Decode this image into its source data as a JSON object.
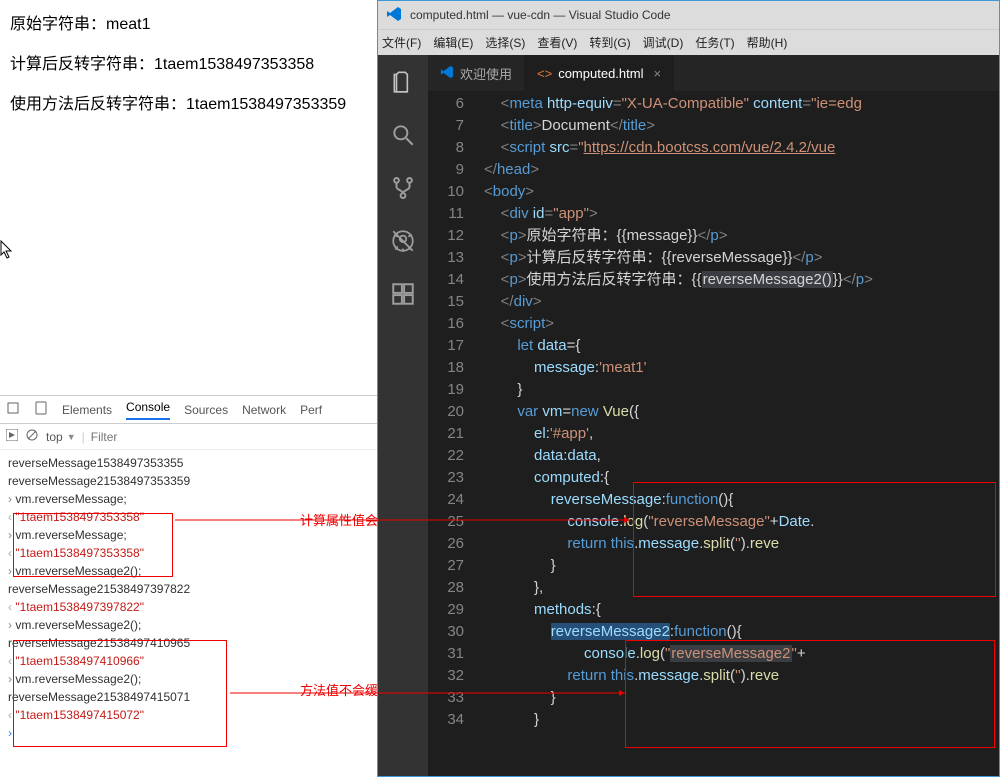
{
  "browser": {
    "line1_label": "原始字符串：",
    "line1_value": "meat1",
    "line2_label": "计算后反转字符串：",
    "line2_value": "1taem1538497353358",
    "line3_label": "使用方法后反转字符串：",
    "line3_value": "1taem1538497353359"
  },
  "devtools": {
    "tabs": {
      "elements": "Elements",
      "console": "Console",
      "sources": "Sources",
      "network": "Network",
      "perf": "Perf"
    },
    "top": "top",
    "filter_placeholder": "Filter",
    "console": [
      {
        "t": "log",
        "txt": "reverseMessage1538497353355"
      },
      {
        "t": "log",
        "txt": "reverseMessage21538497353359"
      },
      {
        "t": "in",
        "txt": "vm.reverseMessage;"
      },
      {
        "t": "out",
        "txt": "\"1taem1538497353358\""
      },
      {
        "t": "in",
        "txt": "vm.reverseMessage;"
      },
      {
        "t": "out",
        "txt": "\"1taem1538497353358\""
      },
      {
        "t": "in",
        "txt": "vm.reverseMessage2();"
      },
      {
        "t": "log",
        "txt": "reverseMessage21538497397822"
      },
      {
        "t": "out",
        "txt": "\"1taem1538497397822\""
      },
      {
        "t": "in",
        "txt": "vm.reverseMessage2();"
      },
      {
        "t": "log",
        "txt": "reverseMessage21538497410965"
      },
      {
        "t": "out",
        "txt": "\"1taem1538497410966\""
      },
      {
        "t": "in",
        "txt": "vm.reverseMessage2();"
      },
      {
        "t": "log",
        "txt": "reverseMessage21538497415071"
      },
      {
        "t": "out",
        "txt": "\"1taem1538497415072\""
      }
    ]
  },
  "annotations": {
    "computed_cache": "计算属性值会缓存",
    "method_nocache": "方法值不会缓存哟"
  },
  "vscode": {
    "title": "computed.html — vue-cdn — Visual Studio Code",
    "menu": {
      "file": "文件(F)",
      "edit": "编辑(E)",
      "select": "选择(S)",
      "view": "查看(V)",
      "go": "转到(G)",
      "debug": "调试(D)",
      "tasks": "任务(T)",
      "help": "帮助(H)"
    },
    "tabs": {
      "welcome": "欢迎使用",
      "active": "computed.html"
    },
    "lines": {
      "start": 6,
      "end": 34
    }
  }
}
